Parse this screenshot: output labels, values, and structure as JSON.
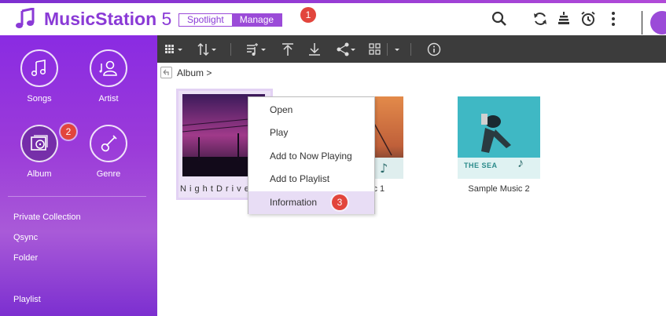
{
  "header": {
    "app_name_bold": "MusicStation",
    "app_name_version": " 5",
    "modes": [
      "Spotlight",
      "Manage"
    ],
    "active_mode": "Manage",
    "callout_1": "1",
    "icons": [
      "music-note-icon",
      "search-icon",
      "refresh-icon",
      "stack-icon",
      "alarm-clock-icon",
      "more-vertical-icon"
    ]
  },
  "sidebar": {
    "tiles": [
      {
        "label": "Songs",
        "icon": "music-note-icon"
      },
      {
        "label": "Artist",
        "icon": "artist-icon"
      },
      {
        "label": "Album",
        "icon": "album-icon",
        "active": true
      },
      {
        "label": "Genre",
        "icon": "guitar-icon"
      }
    ],
    "callout_2": "2",
    "links": [
      "Private Collection",
      "Qsync",
      "Folder",
      "Playlist"
    ]
  },
  "toolbar": {
    "icons": [
      "grid-view-icon",
      "sort-icon",
      "add-to-playlist-icon",
      "move-to-top-icon",
      "download-icon",
      "share-icon",
      "select-icon",
      "more-dropdown-icon",
      "info-icon"
    ]
  },
  "breadcrumb": {
    "text": "Album  >"
  },
  "albums": [
    {
      "name": "N i g h t D r i v e ス",
      "selected": true
    },
    {
      "name": "ic 1"
    },
    {
      "name": "Sample Music 2",
      "cover_caption": "THE SEA"
    }
  ],
  "context_menu": {
    "items": [
      "Open",
      "Play",
      "Add to Now Playing",
      "Add to Playlist",
      "Information"
    ],
    "highlighted": "Information",
    "callout_3": "3"
  },
  "colors": {
    "brand": "#8a3ad6",
    "toolbar": "#3c3c3c",
    "callout": "#e2453c",
    "highlight": "#e8ddf5"
  }
}
